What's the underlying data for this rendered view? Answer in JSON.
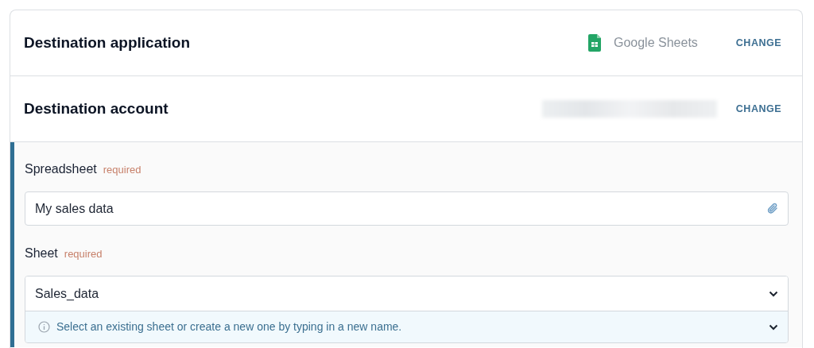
{
  "destination_application": {
    "title": "Destination application",
    "app_name": "Google Sheets",
    "action": "CHANGE"
  },
  "destination_account": {
    "title": "Destination account",
    "action": "CHANGE"
  },
  "spreadsheet": {
    "label": "Spreadsheet",
    "required_tag": "required",
    "value": "My sales data"
  },
  "sheet": {
    "label": "Sheet",
    "required_tag": "required",
    "value": "Sales_data",
    "hint": "Select an existing sheet or create a new one by typing in a new name."
  }
}
